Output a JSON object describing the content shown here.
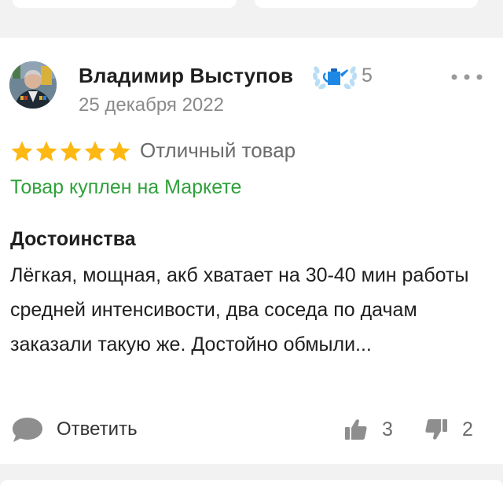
{
  "review": {
    "author": {
      "name": "Владимир Выступов",
      "badge_icon": "laurel-watering-can-badge-icon",
      "badge_count": "5",
      "avatar": "user-avatar-photo"
    },
    "date": "25 декабря 2022",
    "rating": {
      "value": 5,
      "max": 5,
      "label": "Отличный товар"
    },
    "purchase_note": "Товар куплен на Маркете",
    "pros": {
      "title": "Достоинства",
      "text": "Лёгкая, мощная, акб хватает на 30-40 мин работы средней интенсивости, два соседа по дачам заказали такую же. Достойно обмыли..."
    },
    "actions": {
      "reply_label": "Ответить",
      "likes": "3",
      "dislikes": "2"
    }
  },
  "colors": {
    "star": "#fdb813",
    "green_link": "#2ea13a",
    "badge_blue": "#1e88e5",
    "muted": "#8a8a8a"
  }
}
